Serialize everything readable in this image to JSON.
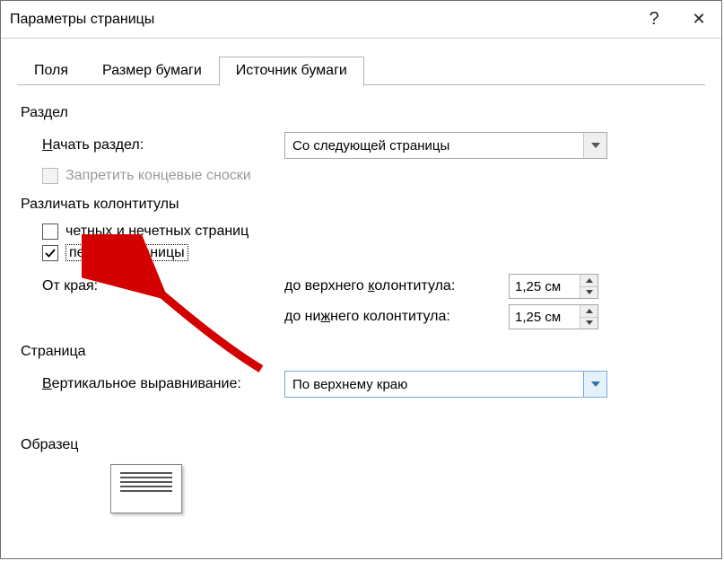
{
  "window": {
    "title": "Параметры страницы",
    "help_icon": "?",
    "close_icon": "✕"
  },
  "tabs": [
    {
      "label": "Поля"
    },
    {
      "label": "Размер бумаги"
    },
    {
      "label": "Источник бумаги"
    }
  ],
  "active_tab": 2,
  "section": {
    "title": "Раздел",
    "start_prefix": "Н",
    "start_suffix": "ачать раздел:",
    "start_value": "Со следующей страницы",
    "suppress_endnotes": "Запретить концевые сноски"
  },
  "headers": {
    "title": "Различать колонтитулы",
    "odd_even": "четных и нечетных страниц",
    "first_page": "первой страницы",
    "from_edge": "От края:",
    "top_label_pre": "до верхнего ",
    "top_label_u": "к",
    "top_label_post": "олонтитула:",
    "bottom_label_pre": "до ни",
    "bottom_label_u": "ж",
    "bottom_label_post": "него колонтитула:",
    "top_value": "1,25 см",
    "bottom_value": "1,25 см"
  },
  "page": {
    "title": "Страница",
    "valign_prefix": "В",
    "valign_suffix": "ертикальное выравнивание:",
    "valign_value": "По верхнему краю"
  },
  "preview": {
    "title": "Образец"
  }
}
